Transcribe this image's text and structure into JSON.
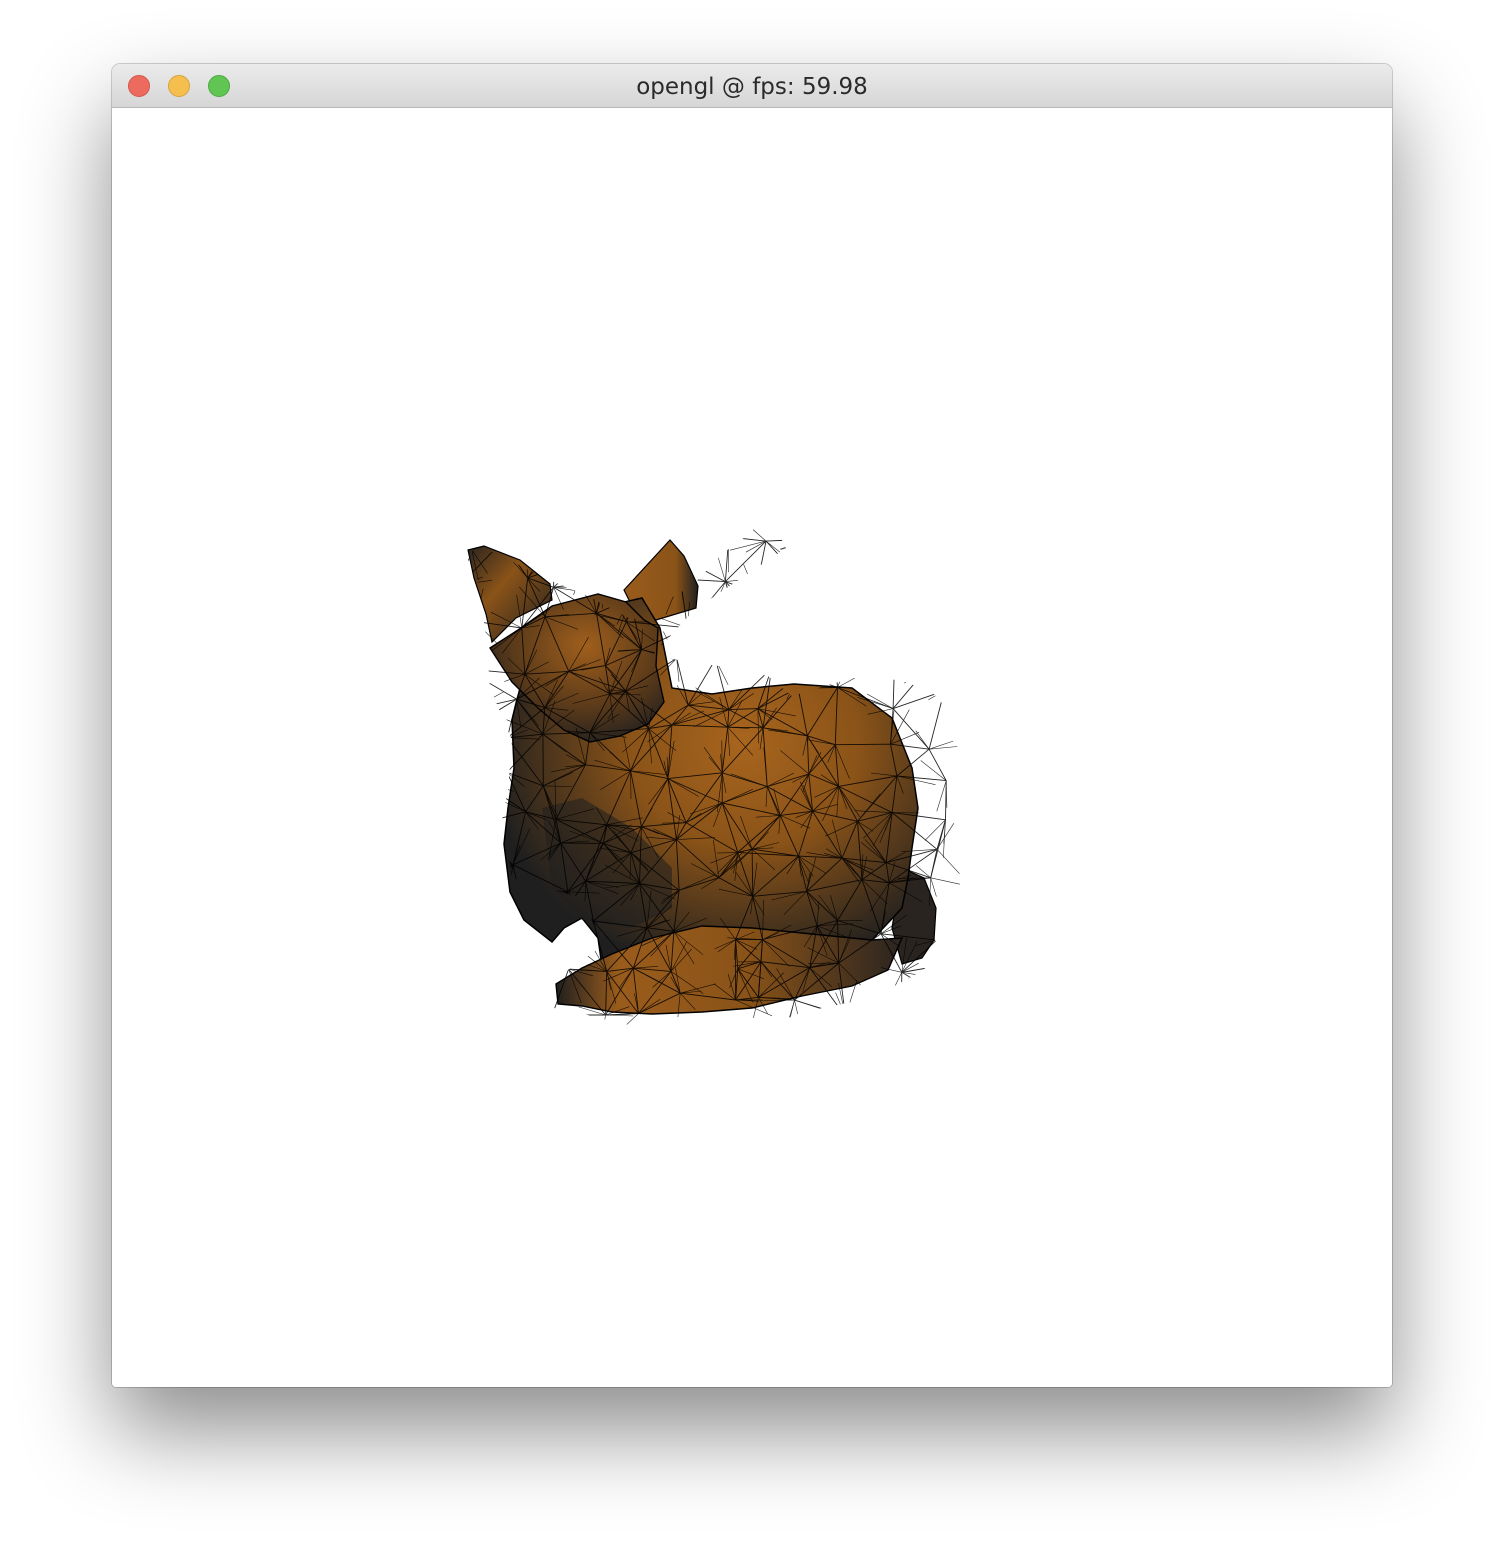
{
  "window": {
    "title": "opengl @ fps: 59.98",
    "buttons": {
      "close": "close-button",
      "minimize": "minimize-button",
      "zoom": "zoom-button"
    }
  },
  "viewport": {
    "background": "#ffffff",
    "model": {
      "name": "bunny",
      "render_mode": "shaded-wireframe",
      "base_color": "#a0601c",
      "shadow_color": "#1f1f1f",
      "wire_color": "#000000"
    }
  }
}
